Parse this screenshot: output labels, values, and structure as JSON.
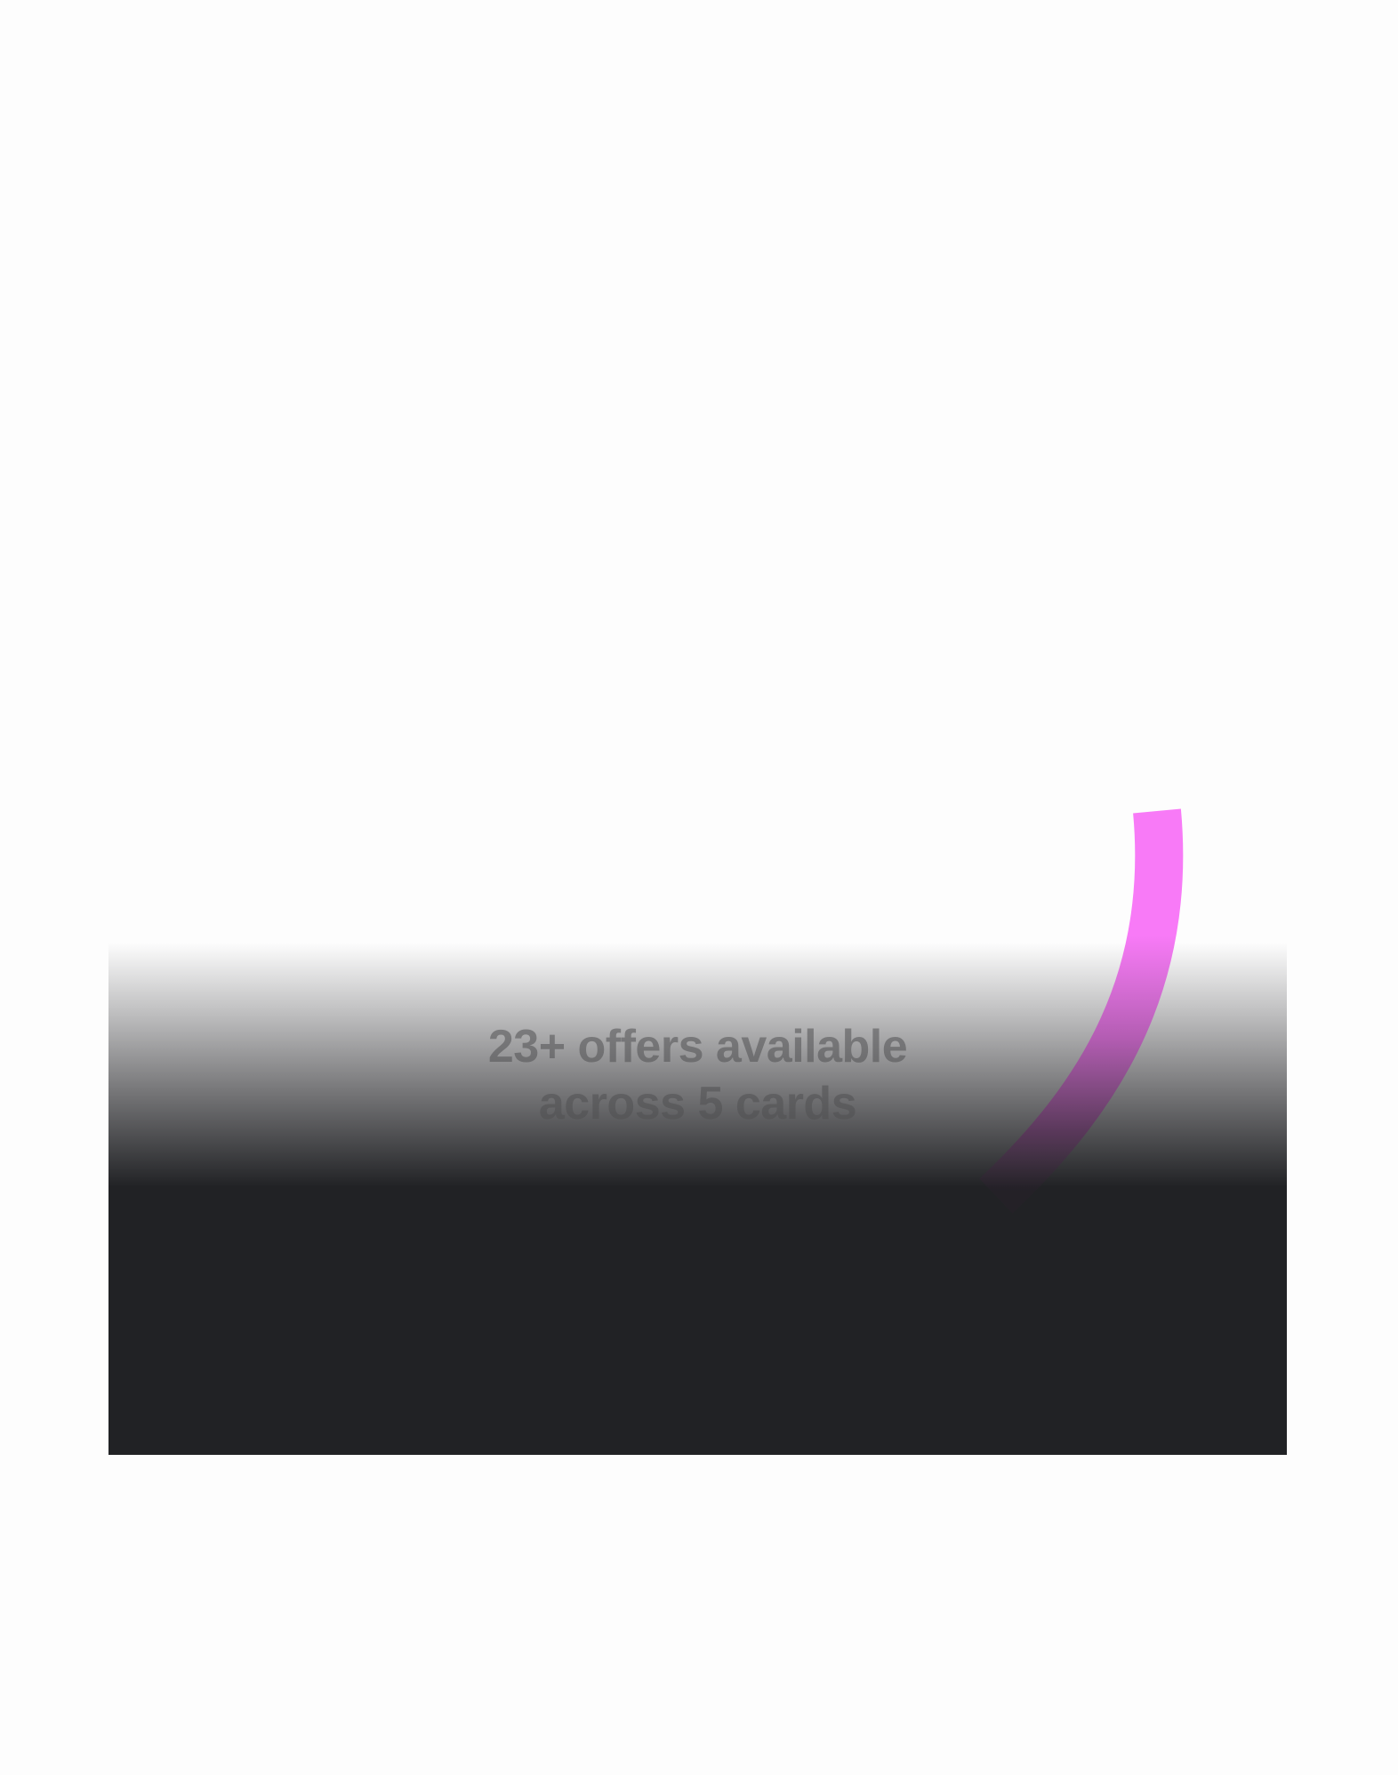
{
  "headline": {
    "line1": "23+ offers available",
    "line2": "across 5 cards"
  },
  "colors": {
    "background": "#fdfdfd",
    "panel_dark": "#212225",
    "accent_arc": "#f87af7",
    "headline_text": "#505052"
  },
  "decoration": {
    "arc_icon": "progress-arc"
  }
}
